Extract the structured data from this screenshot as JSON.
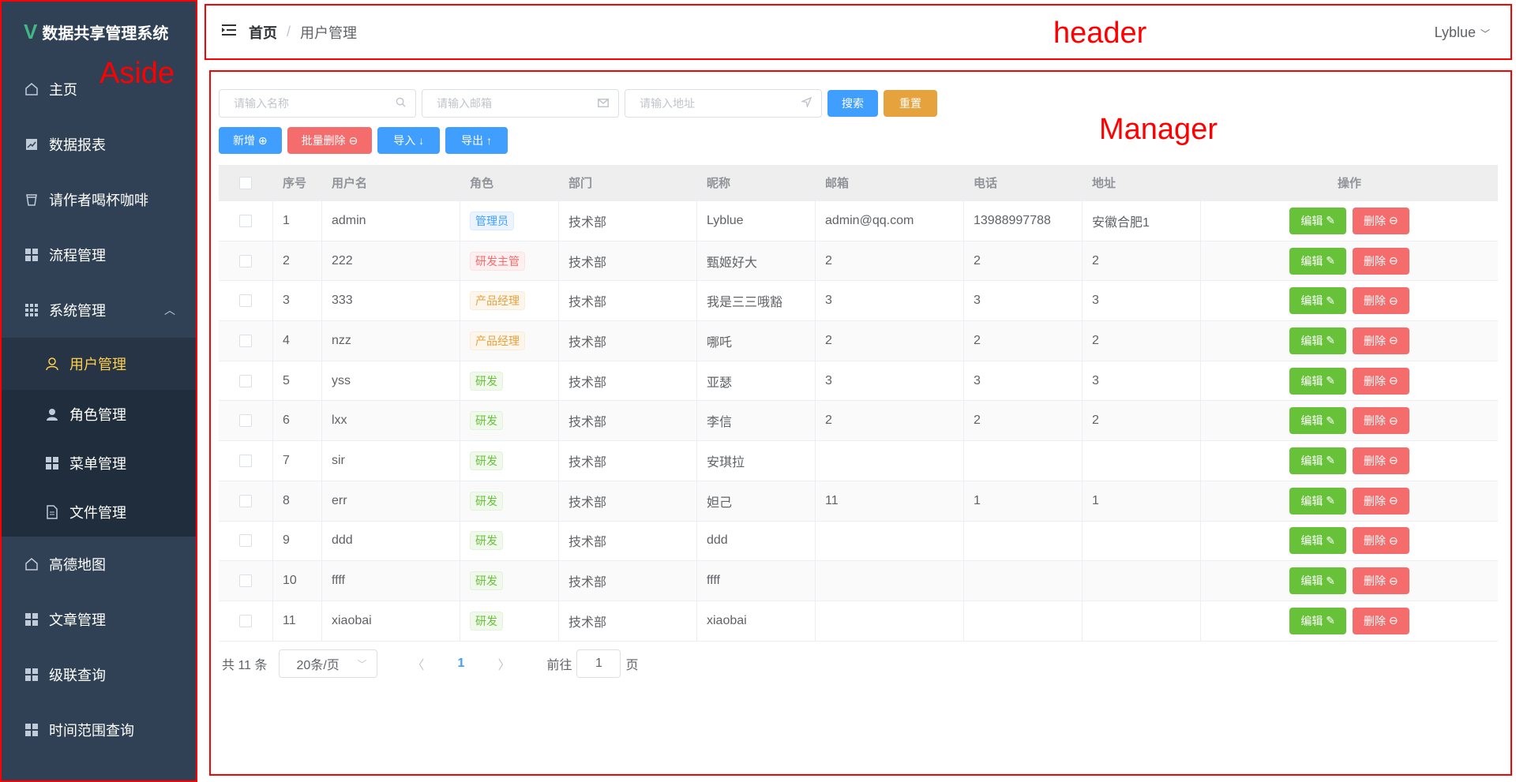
{
  "aside": {
    "title": "数据共享管理系统",
    "label": "Aside",
    "items": [
      {
        "label": "主页",
        "icon": "home-icon"
      },
      {
        "label": "数据报表",
        "icon": "chart-icon"
      },
      {
        "label": "请作者喝杯咖啡",
        "icon": "coffee-icon"
      },
      {
        "label": "流程管理",
        "icon": "grid-icon"
      },
      {
        "label": "系统管理",
        "icon": "apps-icon"
      }
    ],
    "sub_items": [
      {
        "label": "用户管理",
        "icon": "user-icon"
      },
      {
        "label": "角色管理",
        "icon": "user-filled-icon"
      },
      {
        "label": "菜单管理",
        "icon": "grid-icon"
      },
      {
        "label": "文件管理",
        "icon": "document-icon"
      }
    ],
    "items_after": [
      {
        "label": "高德地图",
        "icon": "home-icon"
      },
      {
        "label": "文章管理",
        "icon": "grid-icon"
      },
      {
        "label": "级联查询",
        "icon": "grid-icon"
      },
      {
        "label": "时间范围查询",
        "icon": "grid-icon"
      }
    ]
  },
  "header": {
    "breadcrumb_home": "首页",
    "breadcrumb_sep": "/",
    "breadcrumb_current": "用户管理",
    "label": "header",
    "user": "Lyblue"
  },
  "manager": {
    "label": "Manager",
    "search": {
      "name_placeholder": "请输入名称",
      "email_placeholder": "请输入邮箱",
      "address_placeholder": "请输入地址",
      "search_label": "搜索",
      "reset_label": "重置"
    },
    "actions": {
      "add": "新增",
      "batch_delete": "批量删除",
      "import": "导入",
      "export": "导出"
    },
    "columns": [
      "序号",
      "用户名",
      "角色",
      "部门",
      "昵称",
      "邮箱",
      "电话",
      "地址",
      "操作"
    ],
    "edit_label": "编辑",
    "delete_label": "删除",
    "rows": [
      {
        "id": "1",
        "username": "admin",
        "role": "管理员",
        "role_type": "primary",
        "dept": "技术部",
        "nickname": "Lyblue",
        "email": "admin@qq.com",
        "phone": "13988997788",
        "address": "安徽合肥1"
      },
      {
        "id": "2",
        "username": "222",
        "role": "研发主管",
        "role_type": "danger",
        "dept": "技术部",
        "nickname": "甄姬好大",
        "email": "2",
        "phone": "2",
        "address": "2"
      },
      {
        "id": "3",
        "username": "333",
        "role": "产品经理",
        "role_type": "warning",
        "dept": "技术部",
        "nickname": "我是三三哦豁",
        "email": "3",
        "phone": "3",
        "address": "3"
      },
      {
        "id": "4",
        "username": "nzz",
        "role": "产品经理",
        "role_type": "warning",
        "dept": "技术部",
        "nickname": "哪吒",
        "email": "2",
        "phone": "2",
        "address": "2"
      },
      {
        "id": "5",
        "username": "yss",
        "role": "研发",
        "role_type": "success",
        "dept": "技术部",
        "nickname": "亚瑟",
        "email": "3",
        "phone": "3",
        "address": "3"
      },
      {
        "id": "6",
        "username": "lxx",
        "role": "研发",
        "role_type": "success",
        "dept": "技术部",
        "nickname": "李信",
        "email": "2",
        "phone": "2",
        "address": "2"
      },
      {
        "id": "7",
        "username": "sir",
        "role": "研发",
        "role_type": "success",
        "dept": "技术部",
        "nickname": "安琪拉",
        "email": "",
        "phone": "",
        "address": ""
      },
      {
        "id": "8",
        "username": "err",
        "role": "研发",
        "role_type": "success",
        "dept": "技术部",
        "nickname": "妲己",
        "email": "11",
        "phone": "1",
        "address": "1"
      },
      {
        "id": "9",
        "username": "ddd",
        "role": "研发",
        "role_type": "success",
        "dept": "技术部",
        "nickname": "ddd",
        "email": "",
        "phone": "",
        "address": ""
      },
      {
        "id": "10",
        "username": "ffff",
        "role": "研发",
        "role_type": "success",
        "dept": "技术部",
        "nickname": "ffff",
        "email": "",
        "phone": "",
        "address": ""
      },
      {
        "id": "11",
        "username": "xiaobai",
        "role": "研发",
        "role_type": "success",
        "dept": "技术部",
        "nickname": "xiaobai",
        "email": "",
        "phone": "",
        "address": ""
      }
    ],
    "pagination": {
      "total": "共 11 条",
      "page_size": "20条/页",
      "current_page": "1",
      "goto_prefix": "前往",
      "goto_value": "1",
      "goto_suffix": "页"
    }
  },
  "colors": {
    "sidebar_bg": "#304156",
    "active_menu": "#ffd04b",
    "primary": "#409eff",
    "danger": "#f56c6c",
    "success": "#67c23a",
    "warning": "#e6a23c",
    "annotation_red": "#ff0000"
  }
}
